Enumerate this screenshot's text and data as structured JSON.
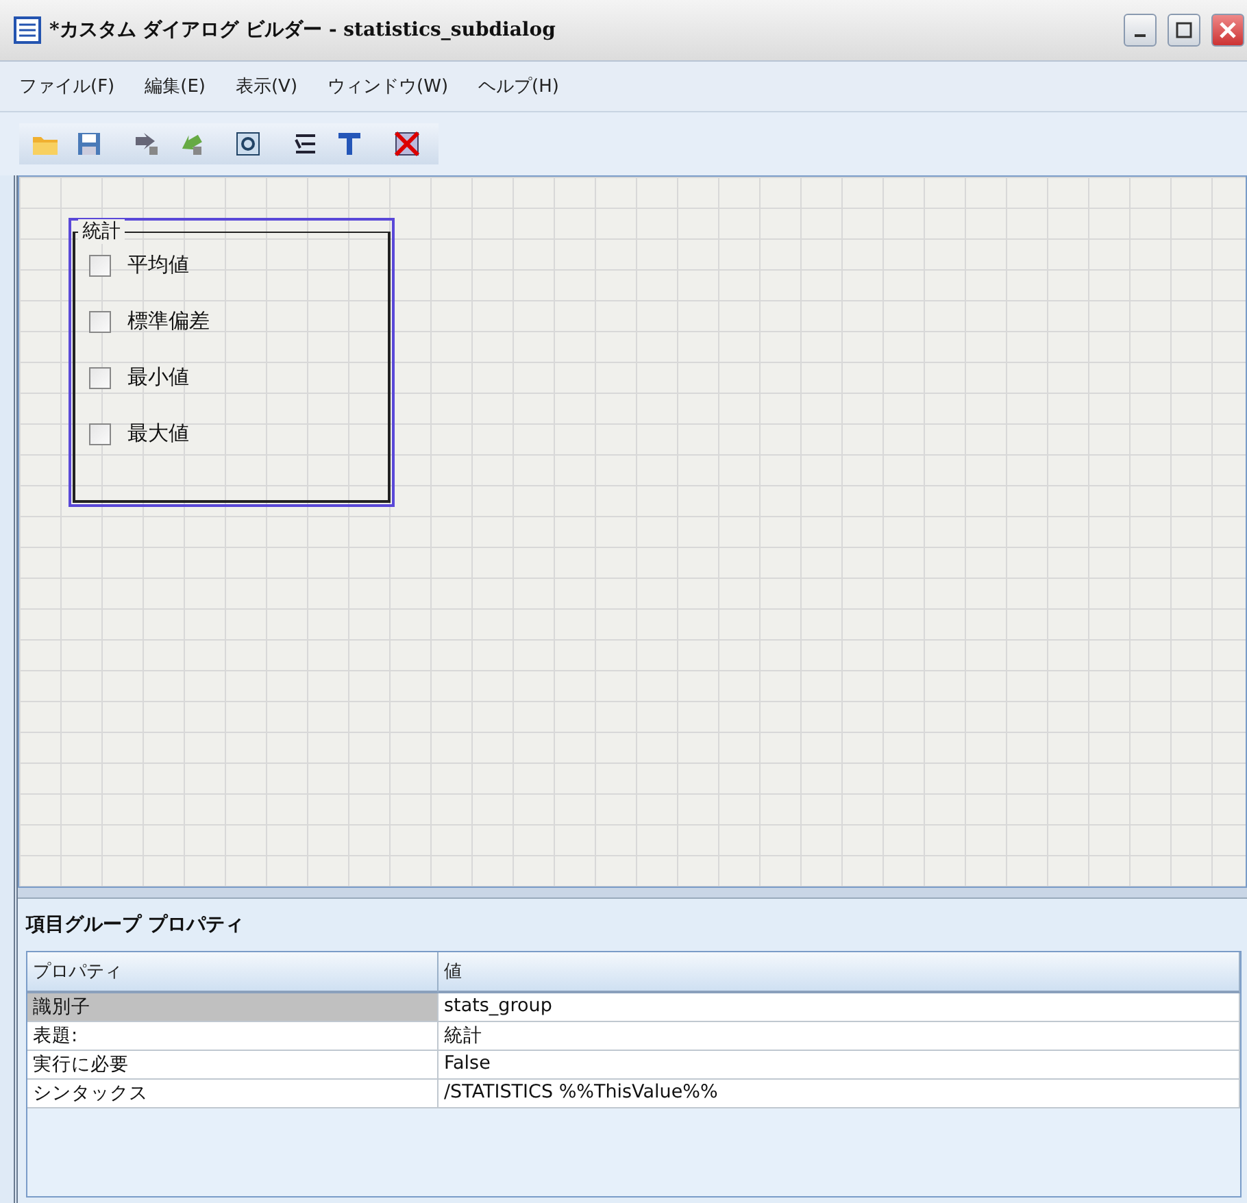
{
  "window": {
    "title": "*カスタム ダイアログ ビルダー - statistics_subdialog"
  },
  "menu": [
    "ファイル(F)",
    "編集(E)",
    "表示(V)",
    "ウィンドウ(W)",
    "ヘルプ(H)"
  ],
  "canvas": {
    "group": {
      "title": "統計",
      "selected": true,
      "items": [
        {
          "label": "平均値",
          "checked": false
        },
        {
          "label": "標準偏差",
          "checked": false
        },
        {
          "label": "最小値",
          "checked": false
        },
        {
          "label": "最大値",
          "checked": false
        }
      ]
    }
  },
  "properties": {
    "title": "項目グループ プロパティ",
    "columns": [
      "プロパティ",
      "値"
    ],
    "rows": [
      {
        "property": "識別子",
        "value": "stats_group",
        "selected": true
      },
      {
        "property": "表題:",
        "value": "統計",
        "selected": false
      },
      {
        "property": "実行に必要",
        "value": "False",
        "selected": false
      },
      {
        "property": "シンタックス",
        "value": "/STATISTICS %%ThisValue%%",
        "selected": false
      }
    ]
  }
}
